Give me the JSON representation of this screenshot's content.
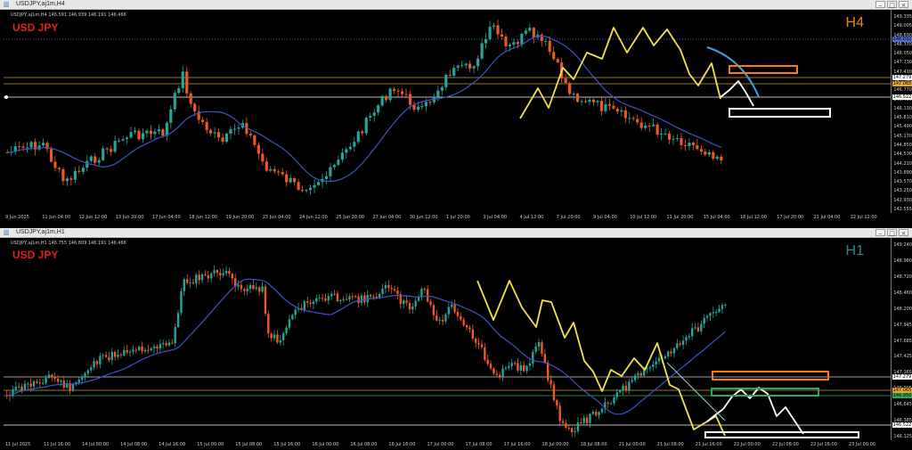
{
  "colors": {
    "bull": "#26a69a",
    "bear": "#ef5a23",
    "ma": "#3a54c8",
    "zigzag": "#f2e34a",
    "orange_box": "#ff7a00",
    "green_box": "#2ea85c",
    "white": "#ffffff",
    "gold_line": "#c8a02a"
  },
  "top": {
    "window_title": "USDJPY,aj1m,H4",
    "info": "USDJPY,aj1m,H4 146.591 146.939 146.191 146.466",
    "symbol": "USD JPY",
    "timeframe": "H4",
    "timeframe_color": "#e8861a",
    "y_ticks": [
      "149.335",
      "149.005",
      "148.690",
      "148.370",
      "148.050",
      "147.730",
      "147.410",
      "147.090",
      "146.770",
      "146.450",
      "146.130",
      "145.810",
      "145.490",
      "145.170",
      "144.850",
      "144.530",
      "144.210",
      "143.890",
      "143.570",
      "143.250",
      "142.930",
      "142.555"
    ],
    "price_boxes": [
      {
        "label": "148.032",
        "color": "#4a6fd6"
      },
      {
        "label": "147.279",
        "color": "#ffffff"
      },
      {
        "label": "147.065",
        "color": "#e8a62a"
      },
      {
        "label": "146.522",
        "color": "#ffffff"
      }
    ],
    "x_ticks": [
      "9 Jun 2025",
      "11 Jun 04:00",
      "12 Jun 12:00",
      "13 Jun 20:00",
      "17 Jun 04:00",
      "18 Jun 12:00",
      "19 Jun 20:00",
      "23 Jun 04:00",
      "24 Jun 12:00",
      "25 Jun 20:00",
      "27 Jun 04:00",
      "30 Jun 12:00",
      "1 Jul 20:00",
      "3 Jul 04:00",
      "4 Jul 12:00",
      "7 Jul 20:00",
      "9 Jul 04:00",
      "10 Jul 12:00",
      "11 Jul 20:00",
      "15 Jul 04:00",
      "16 Jul 12:00",
      "17 Jul 20:00",
      "21 Jul 04:00",
      "22 Jul 12:00"
    ]
  },
  "bottom": {
    "window_title": "USDJPY,aj1m,H1",
    "info": "USDJPY,aj1m,H1 146.755 146.809 146.191 146.466",
    "symbol": "USD JPY",
    "timeframe": "H1",
    "timeframe_color": "#2a8a8a",
    "y_ticks": [
      "149.240",
      "148.980",
      "148.720",
      "148.460",
      "148.200",
      "147.945",
      "147.685",
      "147.425",
      "147.165",
      "146.905",
      "146.645",
      "146.385",
      "146.125"
    ],
    "price_boxes": [
      {
        "label": "147.279",
        "color": "#ffffff"
      },
      {
        "label": "147.065",
        "color": "#e8a62a"
      },
      {
        "label": "146.950",
        "color": "#2ea85c"
      },
      {
        "label": "146.522",
        "color": "#ffffff"
      }
    ],
    "x_ticks": [
      "11 Jul 2025",
      "11 Jul 16:00",
      "14 Jul 00:00",
      "14 Jul 08:00",
      "14 Jul 16:00",
      "15 Jul 00:00",
      "15 Jul 08:00",
      "15 Jul 16:00",
      "16 Jul 00:00",
      "16 Jul 08:00",
      "16 Jul 16:00",
      "17 Jul 00:00",
      "17 Jul 08:00",
      "17 Jul 16:00",
      "18 Jul 00:00",
      "18 Jul 08:00",
      "21 Jul 00:00",
      "21 Jul 08:00",
      "21 Jul 16:00",
      "22 Jul 00:00",
      "22 Jul 08:00",
      "22 Jul 16:00",
      "23 Jul 00:00"
    ]
  }
}
